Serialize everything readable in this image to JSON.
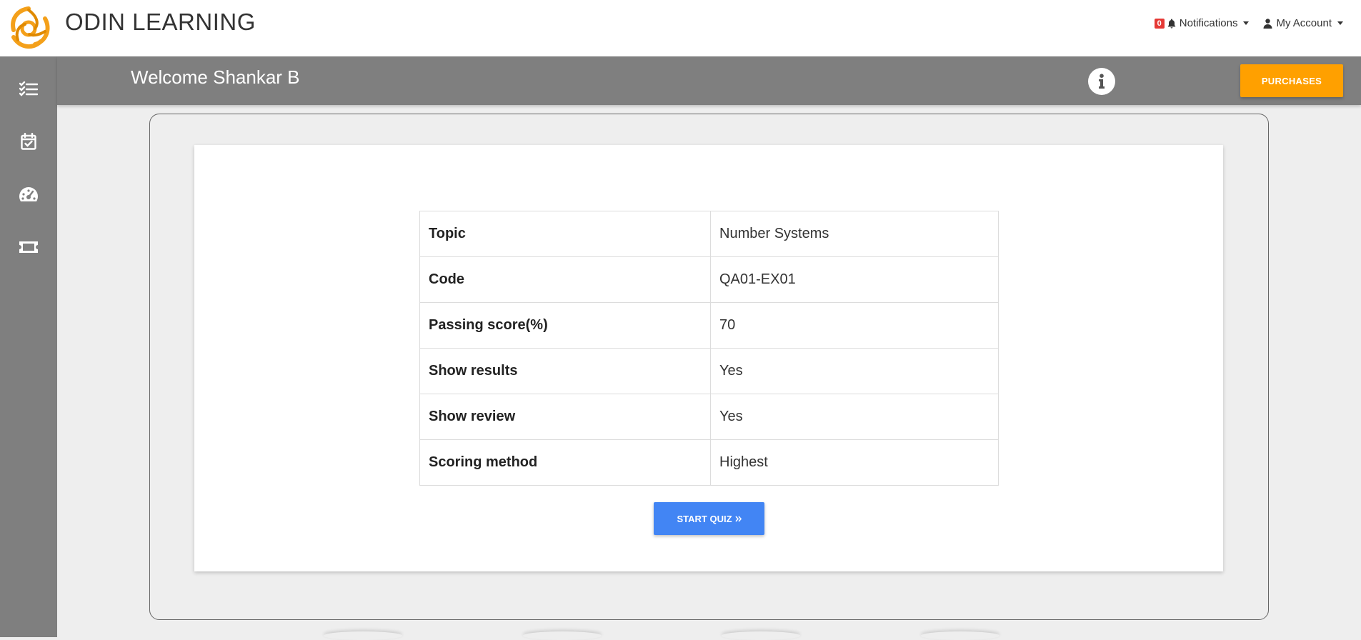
{
  "header": {
    "brand": "ODIN LEARNING",
    "notifications": {
      "count": "0",
      "label": "Notifications",
      "icon": "bell-icon"
    },
    "account": {
      "label": "My Account",
      "icon": "user-icon"
    }
  },
  "sidebar": {
    "items": [
      {
        "icon": "checklist-icon"
      },
      {
        "icon": "calendar-check-icon"
      },
      {
        "icon": "dashboard-gauge-icon"
      },
      {
        "icon": "ticket-icon"
      }
    ]
  },
  "welcome": {
    "text": "Welcome Shankar B",
    "info_icon": "info-icon",
    "purchases_label": "PURCHASES"
  },
  "quiz": {
    "rows": [
      {
        "key": "Topic",
        "value": "Number Systems"
      },
      {
        "key": "Code",
        "value": "QA01-EX01"
      },
      {
        "key": "Passing score(%)",
        "value": "70"
      },
      {
        "key": "Show results",
        "value": "Yes"
      },
      {
        "key": "Show review",
        "value": "Yes"
      },
      {
        "key": "Scoring method",
        "value": "Highest"
      }
    ],
    "start_label": "START QUIZ",
    "start_icon": "double-chevron-right-icon"
  },
  "colors": {
    "accent_orange": "#ffa000",
    "primary_blue": "#4285f4",
    "sidebar_gray": "#7f7f7f",
    "badge_red": "#e53935"
  }
}
